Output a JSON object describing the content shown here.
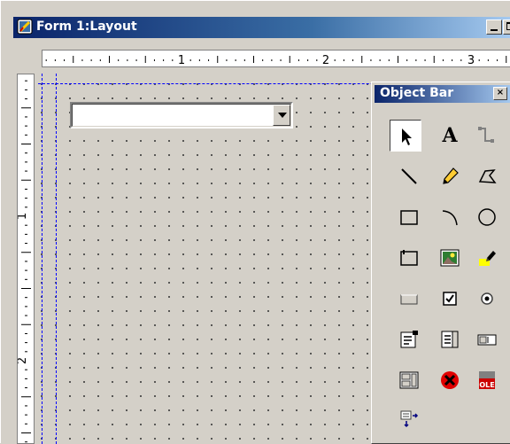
{
  "window": {
    "title": "Form 1:Layout"
  },
  "ruler": {
    "horizontal_labels": [
      "1",
      "2",
      "3"
    ],
    "vertical_labels": [
      "1",
      "2"
    ]
  },
  "form": {
    "combo_value": ""
  },
  "object_bar": {
    "title": "Object Bar",
    "close_glyph": "×",
    "tools": [
      {
        "name": "pointer-tool",
        "icon": "arrow-pointer-icon"
      },
      {
        "name": "text-tool",
        "icon": "text-icon",
        "glyph": "A"
      },
      {
        "name": "connector-tool",
        "icon": "connector-icon"
      },
      {
        "name": "line-tool",
        "icon": "line-icon"
      },
      {
        "name": "pencil-tool",
        "icon": "pencil-icon"
      },
      {
        "name": "polygon-tool",
        "icon": "polygon-icon"
      },
      {
        "name": "rectangle-tool",
        "icon": "rectangle-icon"
      },
      {
        "name": "arc-tool",
        "icon": "arc-icon"
      },
      {
        "name": "ellipse-tool",
        "icon": "ellipse-icon"
      },
      {
        "name": "frame-tool",
        "icon": "frame-icon"
      },
      {
        "name": "picture-tool",
        "icon": "picture-icon"
      },
      {
        "name": "highlighter-tool",
        "icon": "highlighter-icon"
      },
      {
        "name": "button-tool",
        "icon": "button-icon"
      },
      {
        "name": "checkbox-tool",
        "icon": "checkbox-icon"
      },
      {
        "name": "radio-tool",
        "icon": "radio-button-icon"
      },
      {
        "name": "combobox-tool",
        "icon": "combobox-icon"
      },
      {
        "name": "listbox-tool",
        "icon": "listbox-icon"
      },
      {
        "name": "edit-field-tool",
        "icon": "edit-field-icon"
      },
      {
        "name": "multi-edit-tool",
        "icon": "multi-edit-icon"
      },
      {
        "name": "delete-tool",
        "icon": "delete-icon"
      },
      {
        "name": "ole-tool",
        "icon": "ole-icon",
        "glyph": "OLE"
      },
      {
        "name": "subform-tool",
        "icon": "subform-icon"
      }
    ]
  }
}
